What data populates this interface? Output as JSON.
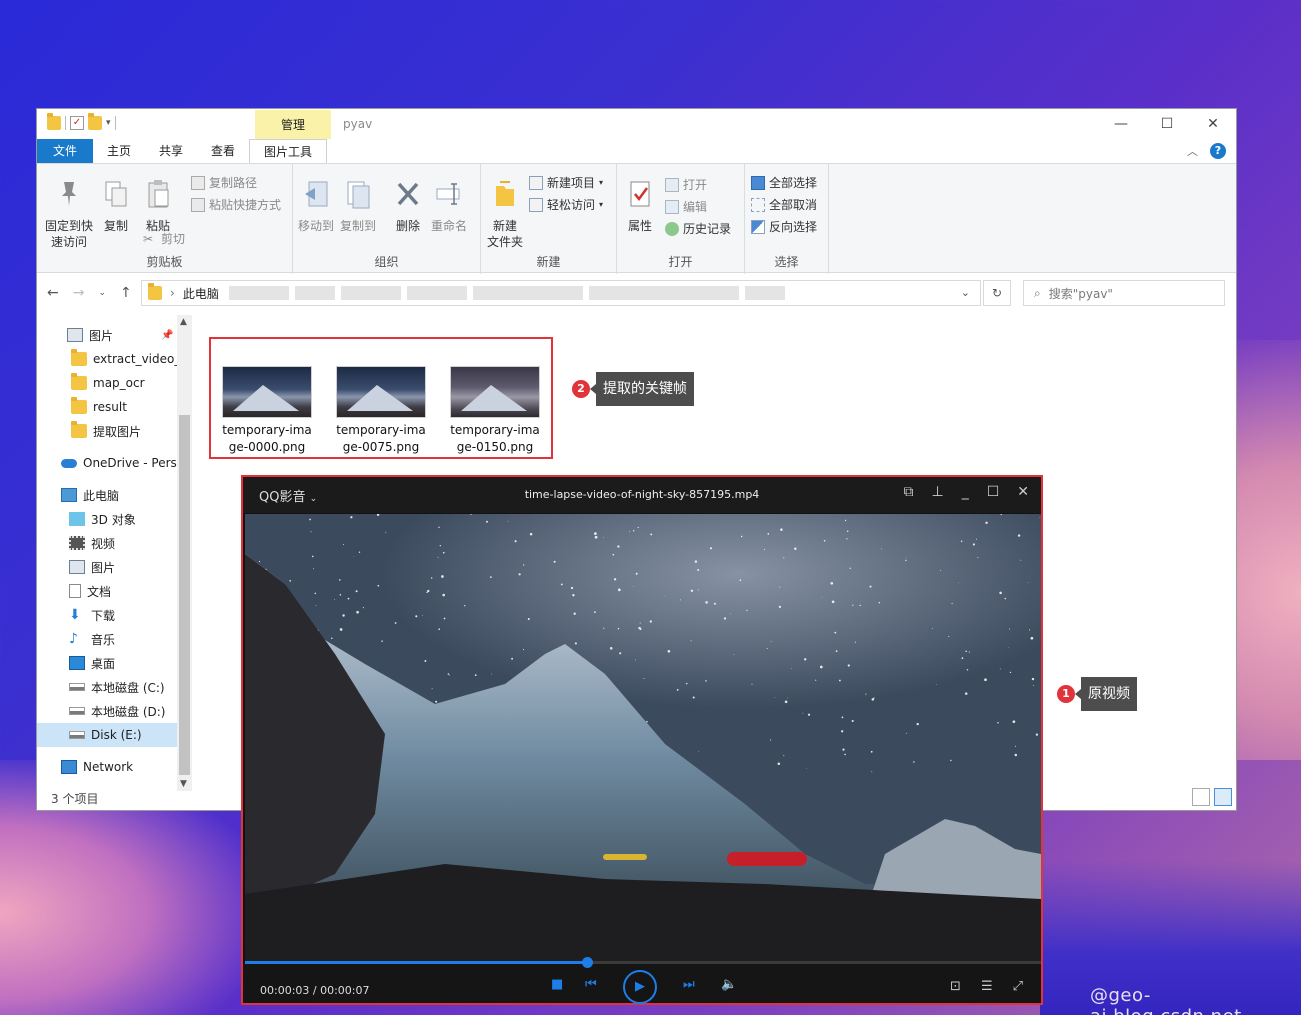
{
  "explorer": {
    "title": "pyav",
    "contextual_tab": "管理",
    "tabs": [
      "文件",
      "主页",
      "共享",
      "查看",
      "图片工具"
    ],
    "ribbon": {
      "clipboard": {
        "label": "剪贴板",
        "pin": "固定到快\n速访问",
        "copy": "复制",
        "paste": "粘贴",
        "copy_path": "复制路径",
        "paste_shortcut": "粘贴快捷方式",
        "cut": "剪切"
      },
      "organize": {
        "label": "组织",
        "move_to": "移动到",
        "copy_to": "复制到",
        "delete": "删除",
        "rename": "重命名"
      },
      "new": {
        "label": "新建",
        "new_folder": "新建\n文件夹",
        "new_item": "新建项目",
        "easy_access": "轻松访问"
      },
      "open": {
        "label": "打开",
        "properties": "属性",
        "open": "打开",
        "edit": "编辑",
        "history": "历史记录"
      },
      "select": {
        "label": "选择",
        "select_all": "全部选择",
        "select_none": "全部取消",
        "invert": "反向选择"
      }
    },
    "address": {
      "root": "此电脑"
    },
    "search_placeholder": "搜索\"pyav\"",
    "nav": [
      {
        "label": "图片",
        "icon": "pictures-icon"
      },
      {
        "label": "extract_video_k",
        "icon": "folder-icon"
      },
      {
        "label": "map_ocr",
        "icon": "folder-icon"
      },
      {
        "label": "result",
        "icon": "folder-icon"
      },
      {
        "label": "提取图片",
        "icon": "folder-icon"
      },
      {
        "label": "OneDrive - Perso",
        "icon": "onedrive-icon"
      },
      {
        "label": "此电脑",
        "icon": "computer-icon"
      },
      {
        "label": "3D 对象",
        "icon": "3d-objects-icon"
      },
      {
        "label": "视频",
        "icon": "videos-icon"
      },
      {
        "label": "图片",
        "icon": "pictures-icon"
      },
      {
        "label": "文档",
        "icon": "documents-icon"
      },
      {
        "label": "下载",
        "icon": "downloads-icon"
      },
      {
        "label": "音乐",
        "icon": "music-icon"
      },
      {
        "label": "桌面",
        "icon": "desktop-icon"
      },
      {
        "label": "本地磁盘 (C:)",
        "icon": "drive-icon"
      },
      {
        "label": "本地磁盘 (D:)",
        "icon": "drive-icon"
      },
      {
        "label": "Disk (E:)",
        "icon": "drive-icon"
      },
      {
        "label": "Network",
        "icon": "network-icon"
      }
    ],
    "files": [
      {
        "name": "temporary-ima\nge-0000.png"
      },
      {
        "name": "temporary-ima\nge-0075.png"
      },
      {
        "name": "temporary-ima\nge-0150.png"
      }
    ],
    "status": "3 个项目"
  },
  "callouts": {
    "keyframes": {
      "num": "2",
      "label": "提取的关键帧"
    },
    "original": {
      "num": "1",
      "label": "原视频"
    }
  },
  "player": {
    "brand": "QQ影音",
    "file": "time-lapse-video-of-night-sky-857195.mp4",
    "time": "00:00:03 / 00:00:07",
    "progress": 0.43
  },
  "watermark": "@geo-ai.blog.csdn.net",
  "colors": {
    "accent": "#1979ca",
    "highlight_border": "#e0333a",
    "player_accent": "#1e7ee8"
  }
}
